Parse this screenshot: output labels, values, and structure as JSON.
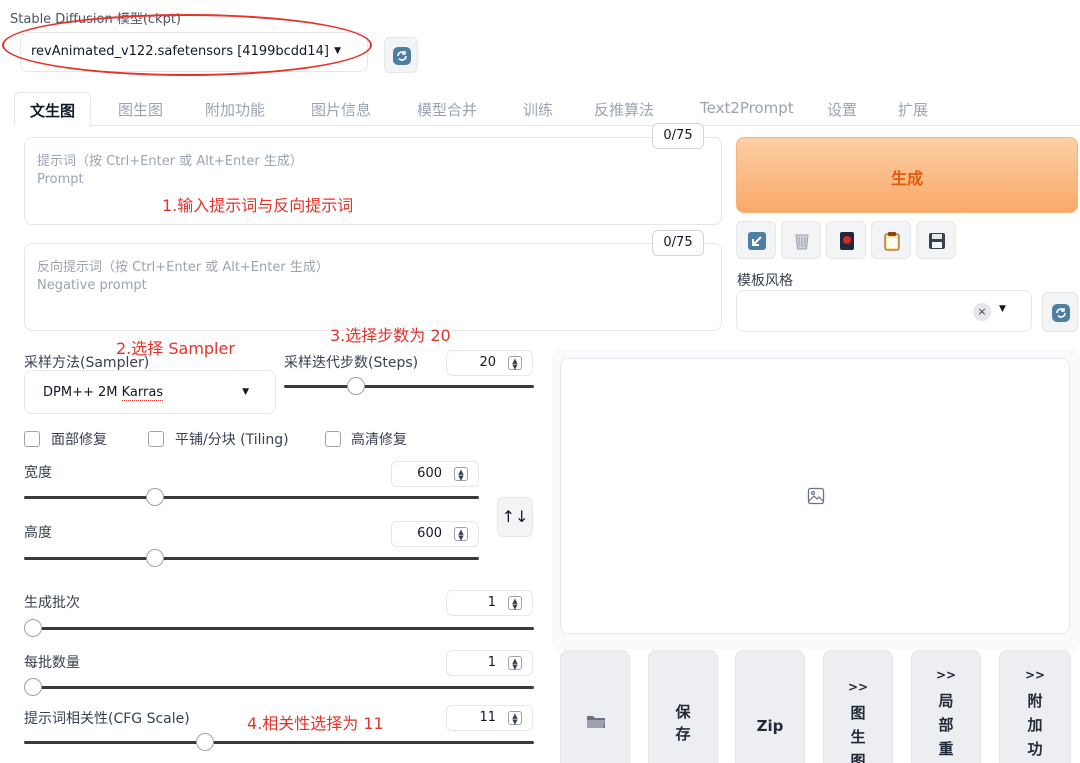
{
  "model": {
    "label": "Stable Diffusion 模型(ckpt)",
    "value": "revAnimated_v122.safetensors [4199bcdd14]"
  },
  "tabs": [
    "文生图",
    "图生图",
    "附加功能",
    "图片信息",
    "模型合并",
    "训练",
    "反推算法",
    "Text2Prompt",
    "设置",
    "扩展"
  ],
  "prompt": {
    "placeholder_zh": "提示词（按 Ctrl+Enter 或 Alt+Enter 生成）",
    "placeholder_en": "Prompt",
    "counter": "0/75"
  },
  "negative_prompt": {
    "placeholder_zh": "反向提示词（按 Ctrl+Enter 或 Alt+Enter 生成）",
    "placeholder_en": "Negative prompt",
    "counter": "0/75"
  },
  "generate_label": "生成",
  "style": {
    "label": "模板风格",
    "clear": "×"
  },
  "annotations": {
    "a1": "1.输入提示词与反向提示词",
    "a2": "2.选择 Sampler",
    "a3": "3.选择步数为 20",
    "a4": "4.相关性选择为 11"
  },
  "sampler": {
    "label": "采样方法(Sampler)",
    "value_prefix": "DPM++ 2M ",
    "value_suffix": "Karras"
  },
  "steps": {
    "label": "采样迭代步数(Steps)",
    "value": "20",
    "fraction": 0.27
  },
  "options": {
    "restore_faces": "面部修复",
    "tiling": "平铺/分块 (Tiling)",
    "hires_fix": "高清修复"
  },
  "width": {
    "label": "宽度",
    "value": "600",
    "fraction": 0.28
  },
  "height": {
    "label": "高度",
    "value": "600",
    "fraction": 0.28
  },
  "batch_count": {
    "label": "生成批次",
    "value": "1",
    "fraction": 0.0
  },
  "batch_size": {
    "label": "每批数量",
    "value": "1",
    "fraction": 0.0
  },
  "cfg": {
    "label": "提示词相关性(CFG Scale)",
    "value": "11",
    "fraction": 0.35
  },
  "swap_icon": "↑↓",
  "bottom_buttons": {
    "save": [
      "保",
      "存"
    ],
    "zip": "Zip",
    "to_img2img": [
      ">>",
      "图",
      "生",
      "图"
    ],
    "to_inpaint": [
      ">>",
      "局",
      "部",
      "重"
    ],
    "to_extras": [
      ">>",
      "附",
      "加",
      "功"
    ]
  },
  "colors": {
    "annotation": "#e5332a",
    "generate_text": "#e35a0c",
    "generate_bg": "#f9a868"
  }
}
